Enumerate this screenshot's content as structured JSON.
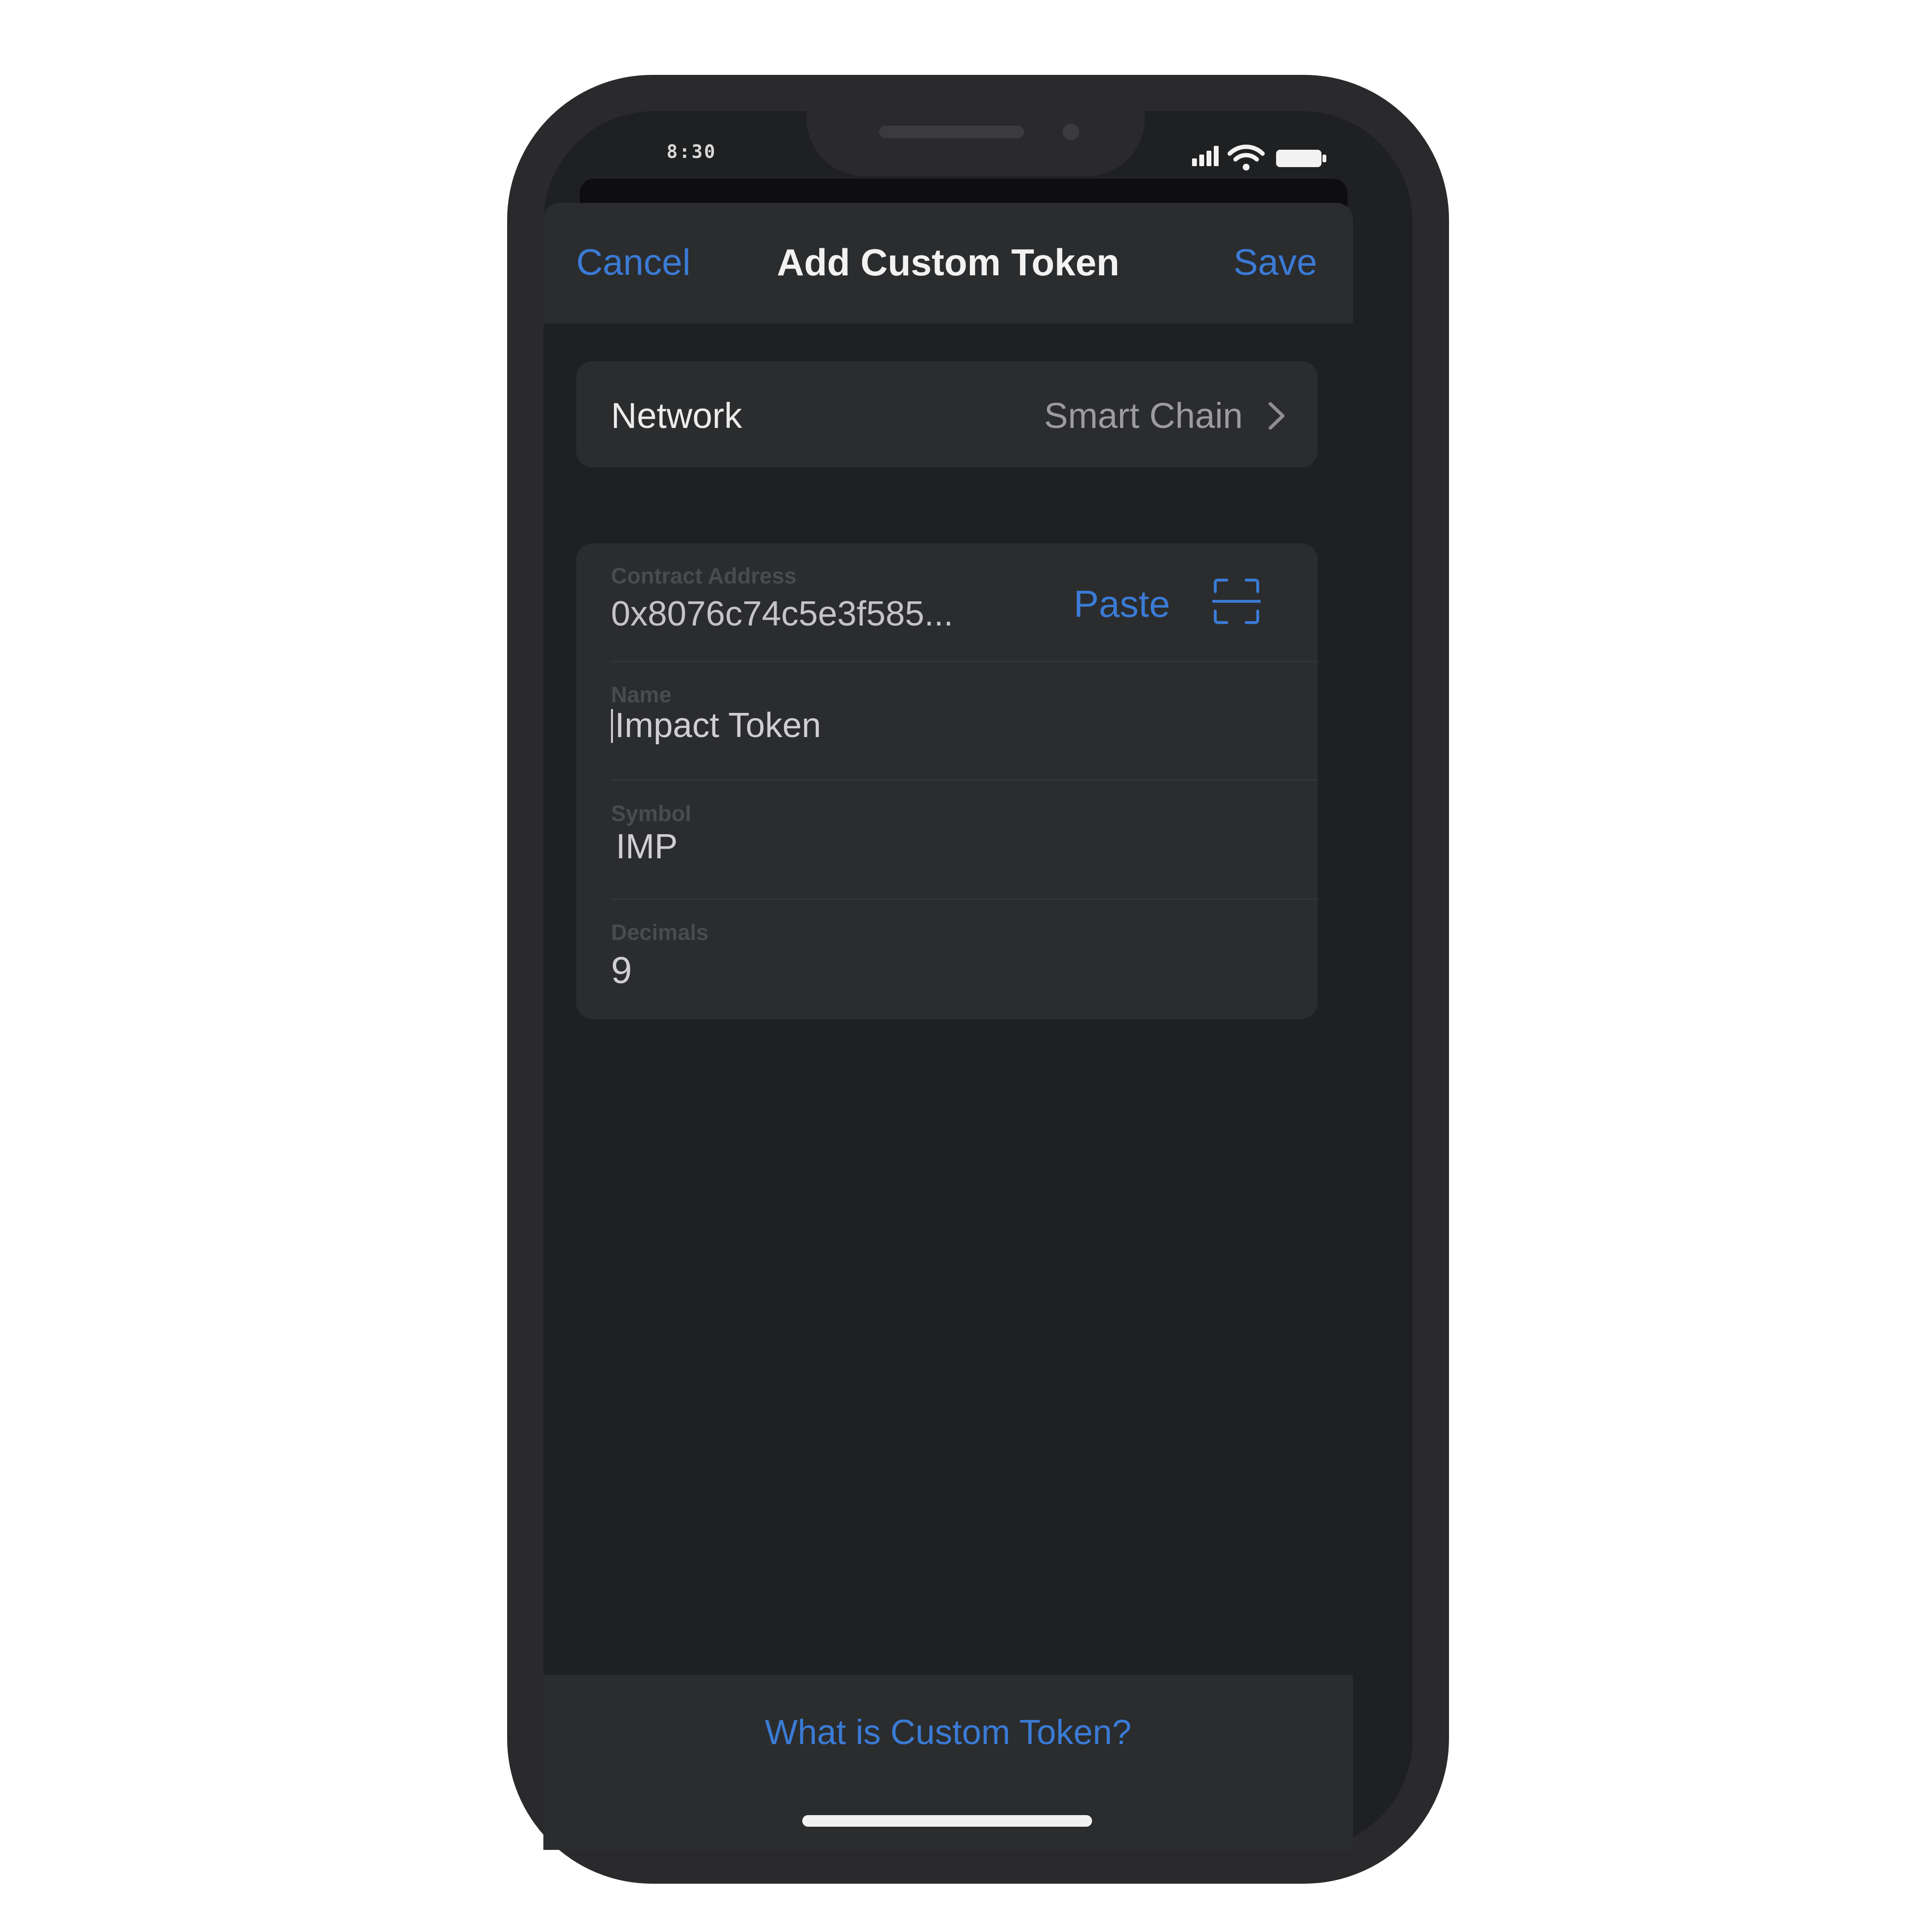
{
  "status_bar": {
    "time": "8:30",
    "icons": [
      "signal-icon",
      "wifi-icon",
      "battery-icon"
    ]
  },
  "navbar": {
    "cancel_label": "Cancel",
    "title": "Add Custom Token",
    "save_label": "Save"
  },
  "network": {
    "label": "Network",
    "value": "Smart Chain",
    "icon": "chevron-right-icon"
  },
  "form": {
    "contract_address": {
      "label": "Contract Address",
      "value": "0x8076c74c5e3f585...",
      "paste_label": "Paste",
      "scan_icon": "scan-qr-icon"
    },
    "name": {
      "label": "Name",
      "value": "Impact Token"
    },
    "symbol": {
      "label": "Symbol",
      "value": "IMP"
    },
    "decimals": {
      "label": "Decimals",
      "value": "9"
    }
  },
  "footer": {
    "help_link": "What is Custom Token?"
  },
  "colors": {
    "accent": "#3a7bd5",
    "background": "#1f2022",
    "card": "#2b2c2e",
    "frame": "#2a2a2c"
  }
}
